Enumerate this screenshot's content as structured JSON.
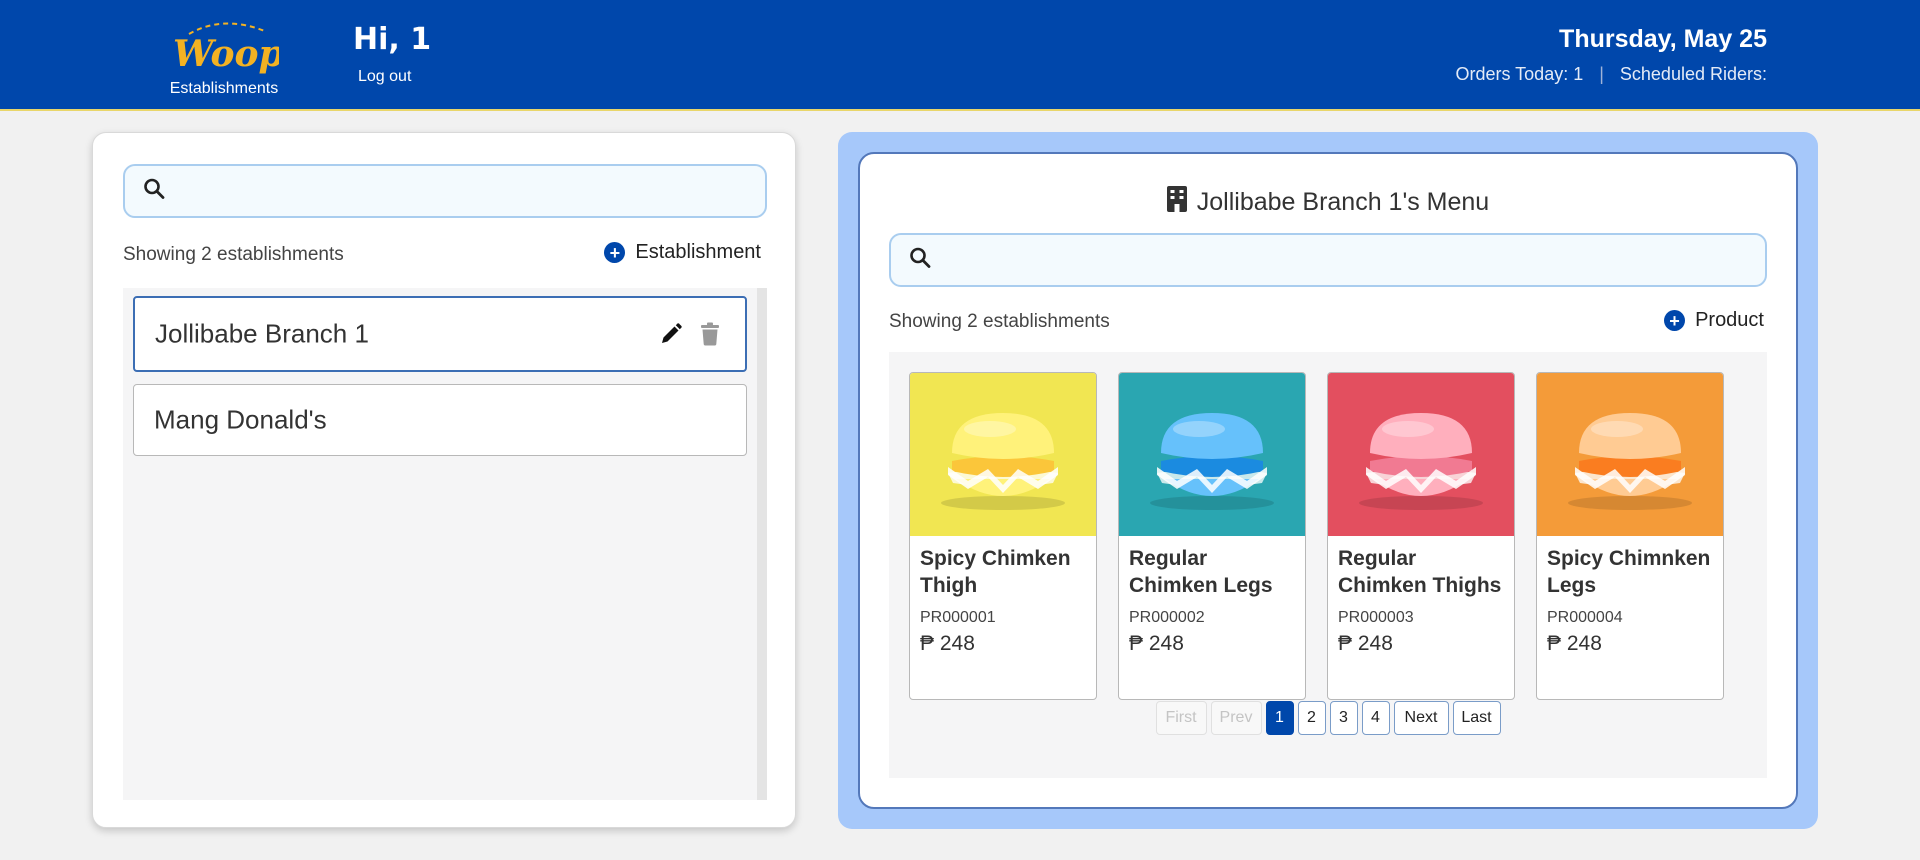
{
  "header": {
    "logo_text": "Woop!",
    "nav_label": "Establishments",
    "greeting": "Hi, 1",
    "logout_label": "Log out",
    "date": "Thursday, May 25",
    "orders_today": "Orders Today: 1",
    "separator": "|",
    "scheduled_riders": "Scheduled Riders:"
  },
  "left": {
    "search": {
      "placeholder": "",
      "value": ""
    },
    "count_text": "Showing 2 establishments",
    "add_label": "Establishment",
    "establishments": [
      {
        "name": "Jollibabe Branch 1",
        "selected": true
      },
      {
        "name": "Mang Donald's",
        "selected": false
      }
    ]
  },
  "right": {
    "menu_title": "Jollibabe Branch 1's Menu",
    "search": {
      "placeholder": "",
      "value": ""
    },
    "count_text": "Showing 2 establishments",
    "add_label": "Product",
    "products": [
      {
        "name": "Spicy Chimken Thigh",
        "code": "PR000001",
        "price": "₱ 248",
        "bg": "#f1e652",
        "bun": "#fff27a",
        "filling": "#fbc63a"
      },
      {
        "name": "Regular Chimken Legs",
        "code": "PR000002",
        "price": "₱ 248",
        "bg": "#2aa6b1",
        "bun": "#66c1fb",
        "filling": "#1b8be0"
      },
      {
        "name": "Regular Chimken Thighs",
        "code": "PR000003",
        "price": "₱ 248",
        "bg": "#e34f5f",
        "bun": "#ffafbd",
        "filling": "#f17a92"
      },
      {
        "name": "Spicy Chimnken Legs",
        "code": "PR000004",
        "price": "₱ 248",
        "bg": "#f49b39",
        "bun": "#ffcb93",
        "filling": "#fa7d20"
      }
    ],
    "pagination": {
      "first": "First",
      "prev": "Prev",
      "pages": [
        "1",
        "2",
        "3",
        "4"
      ],
      "current": "1",
      "next": "Next",
      "last": "Last"
    }
  },
  "colors": {
    "brand": "#0047ab",
    "accent_yellow": "#e9d66a",
    "panel_blue": "#a6c8fa"
  },
  "icons": {
    "search": "search-icon",
    "plus": "plus-circle-icon",
    "edit": "pencil-icon",
    "delete": "trash-icon",
    "building": "building-icon"
  }
}
